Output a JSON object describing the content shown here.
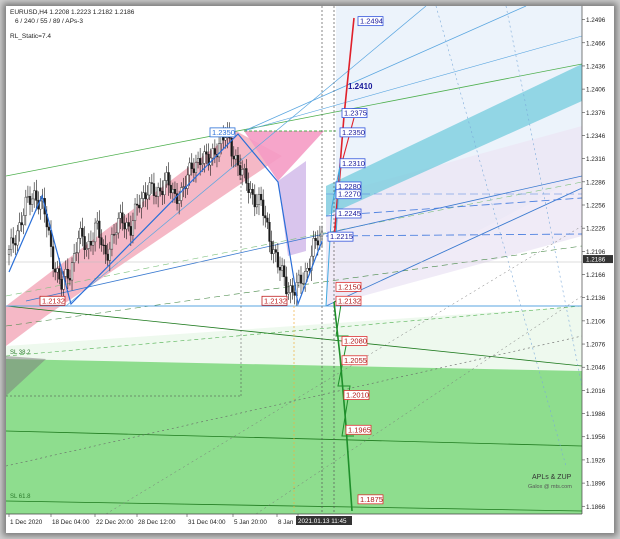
{
  "header": {
    "symbol_line": "EURUSD,H4  1.2208 1.2223 1.2182 1.2186",
    "zup_line": "6 / 240 / 55 / 89 / APs-3",
    "indicator_line": "RL_Static=7.4"
  },
  "watermark": {
    "line1": "APLs & ZUP",
    "line2": "Galox @ mts.com"
  },
  "colors": {
    "bull": "#1a1a1a",
    "pink": "#f2a6b8",
    "cyan": "#6cc9dc",
    "green": "#6ed36e",
    "lavender": "#ece6f5",
    "pale_blue": "#eaf2fb",
    "red_path": "#e0202a",
    "green_path": "#1e8e2a",
    "blue_level": "#3355dd",
    "red_level": "#dd3333"
  },
  "chart_data": {
    "type": "candlestick",
    "symbol": "EURUSD",
    "timeframe": "H4",
    "ohlc_header": {
      "open": 1.2208,
      "high": 1.2223,
      "low": 1.2182,
      "close": 1.2186
    },
    "y_ticks": [
      "1.2496",
      "1.2466",
      "1.2436",
      "1.2406",
      "1.2376",
      "1.2346",
      "1.2316",
      "1.2286",
      "1.2256",
      "1.2226",
      "1.2196",
      "1.2166",
      "1.2136",
      "1.2106",
      "1.2076",
      "1.2046",
      "1.2016",
      "1.1986",
      "1.1956",
      "1.1926",
      "1.1896",
      "1.1866"
    ],
    "ylim": [
      1.1856,
      1.2511
    ],
    "current_price": "1.2186",
    "x_ticks": [
      "1 Dec 2020",
      "18 Dec 04:00",
      "22 Dec 20:00",
      "28 Dec 12:00",
      "31 Dec 04:00",
      "5 Jan 20:00",
      "8 Jan",
      "2021.01.13 11:45"
    ],
    "path_series": [
      [
        0,
        1.2192
      ],
      [
        3.5,
        1.227
      ],
      [
        6.5,
        1.2136
      ],
      [
        25,
        1.235
      ],
      [
        29,
        1.226
      ],
      [
        31,
        1.214
      ],
      [
        33,
        1.219
      ]
    ],
    "price_swing": [
      {
        "i": 0,
        "p": 1.2192
      },
      {
        "i": 1,
        "p": 1.2225
      },
      {
        "i": 2,
        "p": 1.2255
      },
      {
        "i": 3,
        "p": 1.2272
      },
      {
        "i": 4,
        "p": 1.225
      },
      {
        "i": 5,
        "p": 1.219
      },
      {
        "i": 6,
        "p": 1.215
      },
      {
        "i": 7,
        "p": 1.217
      },
      {
        "i": 8,
        "p": 1.2215
      },
      {
        "i": 9,
        "p": 1.22
      },
      {
        "i": 10,
        "p": 1.223
      },
      {
        "i": 11,
        "p": 1.219
      },
      {
        "i": 12,
        "p": 1.2215
      },
      {
        "i": 13,
        "p": 1.224
      },
      {
        "i": 14,
        "p": 1.2225
      },
      {
        "i": 15,
        "p": 1.226
      },
      {
        "i": 16,
        "p": 1.228
      },
      {
        "i": 17,
        "p": 1.2265
      },
      {
        "i": 18,
        "p": 1.2295
      },
      {
        "i": 19,
        "p": 1.226
      },
      {
        "i": 20,
        "p": 1.228
      },
      {
        "i": 21,
        "p": 1.23
      },
      {
        "i": 22,
        "p": 1.232
      },
      {
        "i": 23,
        "p": 1.231
      },
      {
        "i": 24,
        "p": 1.2335
      },
      {
        "i": 25,
        "p": 1.2345
      },
      {
        "i": 26,
        "p": 1.232
      },
      {
        "i": 27,
        "p": 1.229
      },
      {
        "i": 28,
        "p": 1.227
      },
      {
        "i": 29,
        "p": 1.2255
      },
      {
        "i": 30,
        "p": 1.2215
      },
      {
        "i": 31,
        "p": 1.2175
      },
      {
        "i": 32,
        "p": 1.215
      },
      {
        "i": 33,
        "p": 1.2145
      },
      {
        "i": 34,
        "p": 1.2165
      },
      {
        "i": 35,
        "p": 1.22
      },
      {
        "i": 36,
        "p": 1.2215
      }
    ],
    "up_targets": [
      {
        "label": "1.2494",
        "price": 1.2494
      },
      {
        "label": "1.2410",
        "price": 1.241
      },
      {
        "label": "1.2375",
        "price": 1.2375
      },
      {
        "label": "1.2350",
        "price": 1.235
      },
      {
        "label": "1.2310",
        "price": 1.231
      },
      {
        "label": "1.2280",
        "price": 1.228
      },
      {
        "label": "1.2270",
        "price": 1.227
      },
      {
        "label": "1.2245",
        "price": 1.2245
      },
      {
        "label": "1.2215",
        "price": 1.2215
      }
    ],
    "down_targets": [
      {
        "label": "1.2150",
        "price": 1.215
      },
      {
        "label": "1.2132",
        "price": 1.2132
      },
      {
        "label": "1.2080",
        "price": 1.208
      },
      {
        "label": "1.2055",
        "price": 1.2055
      },
      {
        "label": "1.2010",
        "price": 1.201
      },
      {
        "label": "1.1965",
        "price": 1.1965
      },
      {
        "label": "1.1875",
        "price": 1.1875
      }
    ],
    "pivot_labels": [
      {
        "label": "1.2350",
        "price": 1.235
      },
      {
        "label": "1.2132",
        "price": 1.2132
      },
      {
        "label": "1.2132",
        "price": 1.2132
      }
    ],
    "fib_labels": [
      "SL 38.2",
      "SL 61.8"
    ]
  }
}
